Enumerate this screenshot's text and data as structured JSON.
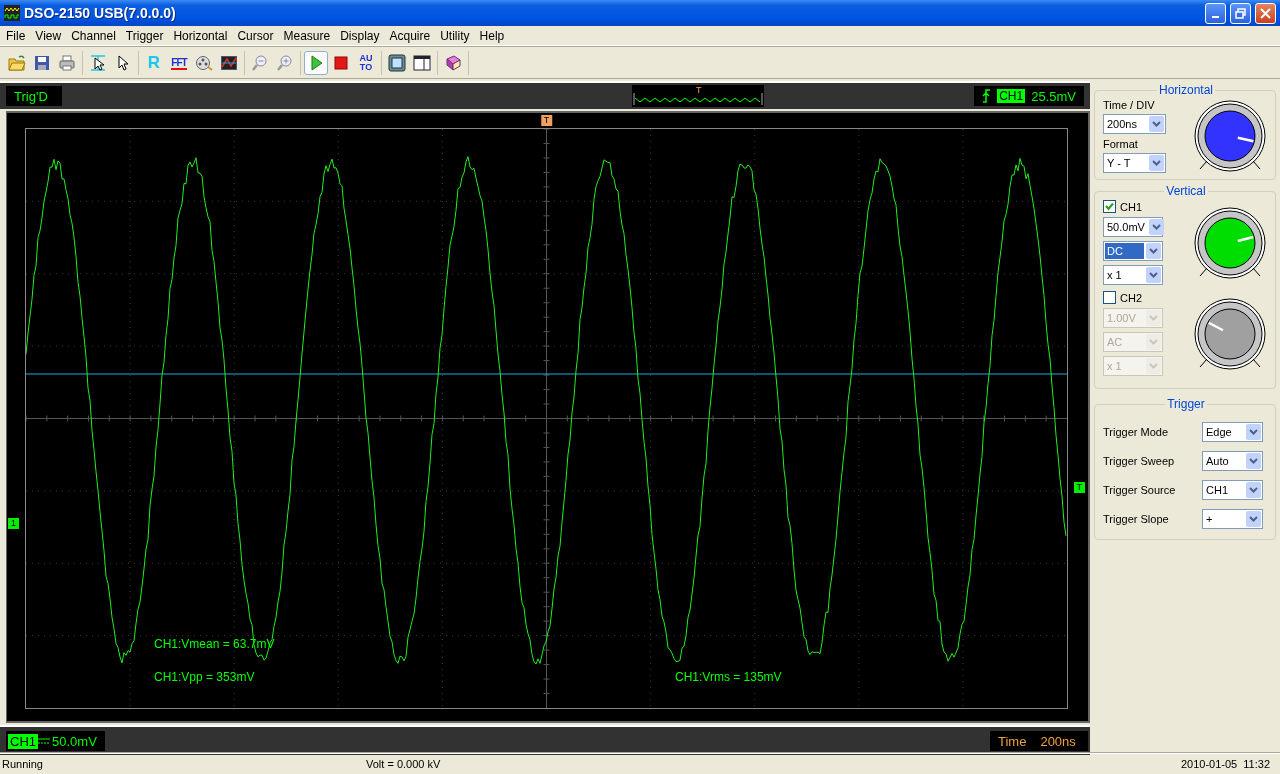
{
  "window": {
    "title": "DSO-2150 USB(7.0.0.0)"
  },
  "menu": [
    "File",
    "View",
    "Channel",
    "Trigger",
    "Horizontal",
    "Cursor",
    "Measure",
    "Display",
    "Acquire",
    "Utility",
    "Help"
  ],
  "toolbar": [
    [
      {
        "kind": "open",
        "pressed": false
      },
      {
        "kind": "save",
        "pressed": false
      },
      {
        "kind": "print",
        "pressed": false
      }
    ],
    [
      {
        "kind": "cursor",
        "pressed": false
      },
      {
        "kind": "pointer",
        "pressed": false
      }
    ],
    [
      {
        "kind": "letter",
        "label": "R",
        "pressed": false
      },
      {
        "kind": "fft",
        "label": "FFT",
        "pressed": false
      },
      {
        "kind": "reel",
        "pressed": false
      },
      {
        "kind": "math",
        "pressed": false
      }
    ],
    [
      {
        "kind": "zoom-out",
        "pressed": false
      },
      {
        "kind": "zoom-in",
        "pressed": false
      }
    ],
    [
      {
        "kind": "run",
        "pressed": true
      },
      {
        "kind": "stop",
        "pressed": false
      },
      {
        "kind": "auto",
        "label_lines": [
          "AU",
          "TO"
        ],
        "pressed": false
      }
    ],
    [
      {
        "kind": "fit",
        "pressed": false
      },
      {
        "kind": "panel",
        "pressed": false
      }
    ],
    [
      {
        "kind": "book",
        "pressed": false
      }
    ]
  ],
  "scope": {
    "status": "Trig'D",
    "preview_marker": "T",
    "trigger": {
      "channel": "CH1",
      "value": "25.5mV"
    },
    "markers": [
      {
        "kind": "top",
        "text": "T"
      },
      {
        "kind": "left",
        "text": "1"
      },
      {
        "kind": "right",
        "text": "T"
      }
    ],
    "measurements": [
      "CH1:Vmean = 63.7mV",
      "CH1:Vpp = 353mV",
      "CH1:Vrms = 135mV"
    ],
    "bottom": {
      "channel": "CH1",
      "scale": "50.0mV",
      "time_label": "Time",
      "time_value": "200ns"
    }
  },
  "panel": {
    "horizontal": {
      "title": "Horizontal",
      "fields": [
        {
          "label": "Time / DIV",
          "value": "200ns"
        },
        {
          "label": "Format",
          "value": "Y - T"
        }
      ],
      "knob": {
        "color": "#3333ff"
      }
    },
    "vertical": {
      "title": "Vertical",
      "channels": [
        {
          "name": "CH1",
          "checked": true,
          "selects": [
            {
              "value": "50.0mV",
              "focused": false,
              "disabled": false
            },
            {
              "value": "DC",
              "focused": true,
              "disabled": false
            },
            {
              "value": "x 1",
              "focused": false,
              "disabled": false
            }
          ],
          "knob": {
            "color": "#00dd00"
          }
        },
        {
          "name": "CH2",
          "checked": false,
          "selects": [
            {
              "value": "1.00V",
              "focused": false,
              "disabled": true
            },
            {
              "value": "AC",
              "focused": false,
              "disabled": true
            },
            {
              "value": "x 1",
              "focused": false,
              "disabled": true
            }
          ],
          "knob": {
            "color": "#a0a0a0"
          }
        }
      ]
    },
    "trigger": {
      "title": "Trigger",
      "rows": [
        {
          "label": "Trigger Mode",
          "value": "Edge"
        },
        {
          "label": "Trigger Sweep",
          "value": "Auto"
        },
        {
          "label": "Trigger Source",
          "value": "CH1"
        },
        {
          "label": "Trigger Slope",
          "value": "+"
        }
      ]
    }
  },
  "status_bar": [
    "Running",
    "Volt = 0.000 kV",
    "2010-01-05  11:32"
  ]
}
